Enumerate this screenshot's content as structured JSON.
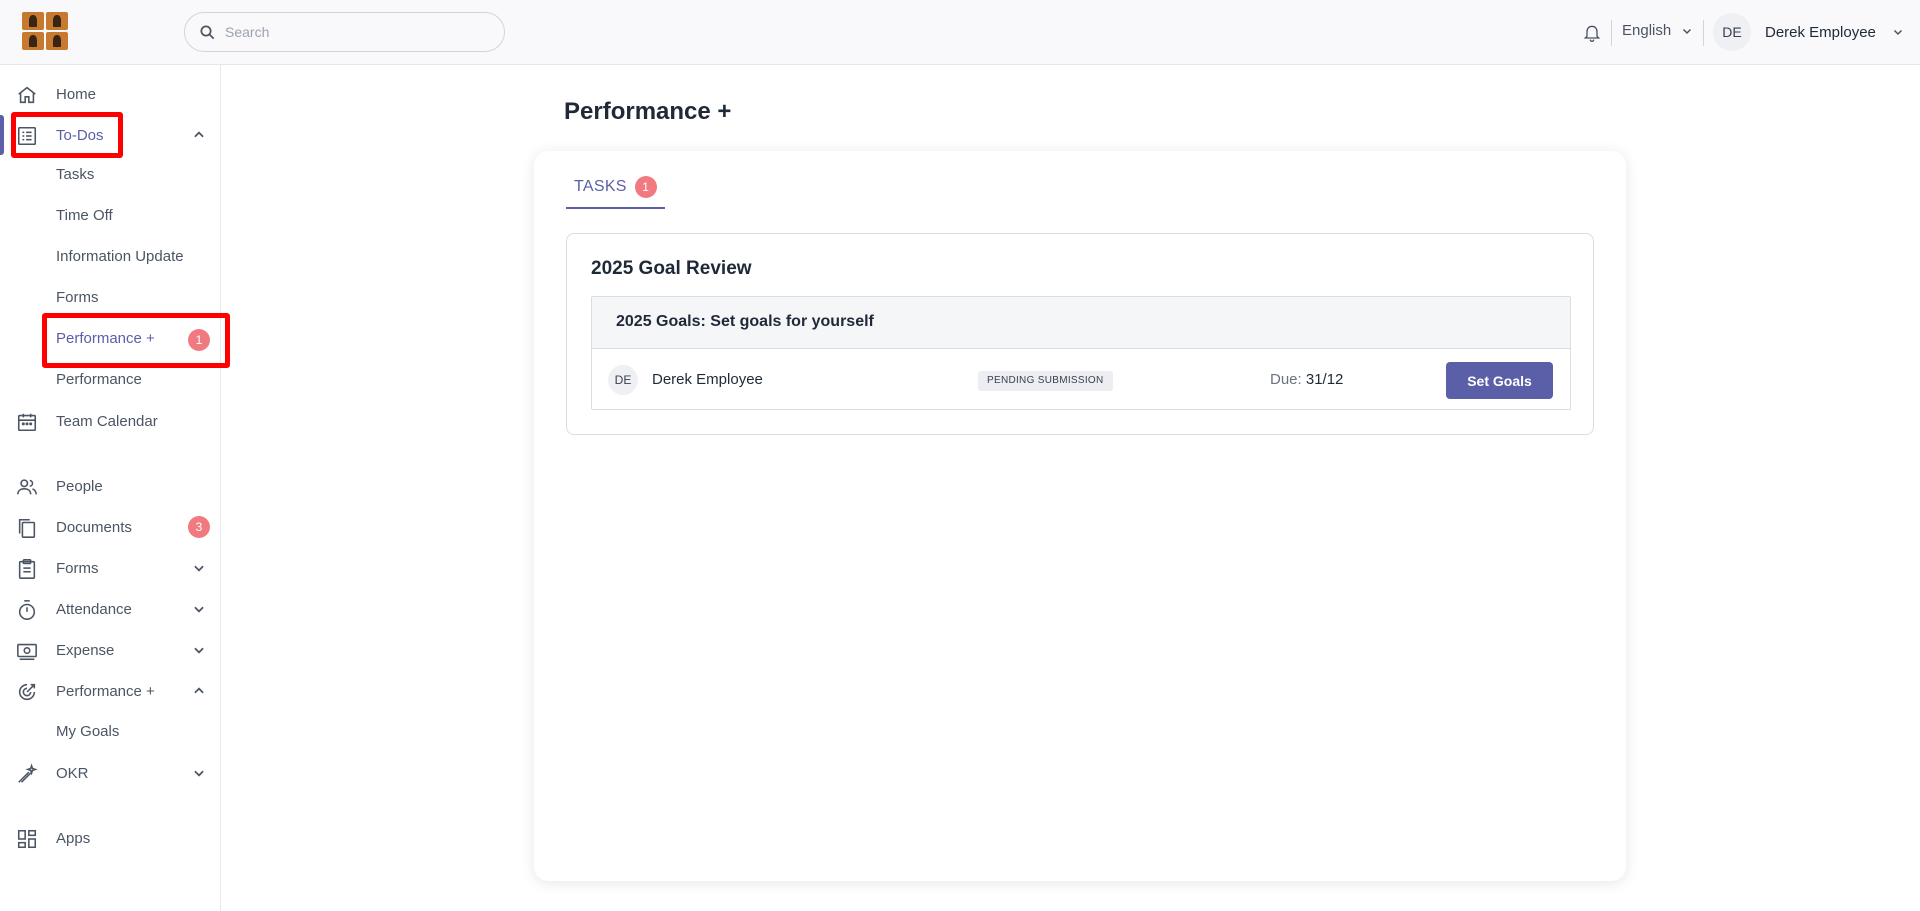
{
  "header": {
    "search_placeholder": "Search",
    "language": "English",
    "user_initials": "DE",
    "user_name": "Derek Employee"
  },
  "sidebar": {
    "items": [
      {
        "label": "Home",
        "icon": "home-icon"
      },
      {
        "label": "To-Dos",
        "icon": "list-icon"
      },
      {
        "label": "Team Calendar",
        "icon": "calendar-icon"
      },
      {
        "label": "People",
        "icon": "people-icon"
      },
      {
        "label": "Documents",
        "icon": "documents-icon",
        "badge": "3"
      },
      {
        "label": "Forms",
        "icon": "clipboard-icon"
      },
      {
        "label": "Attendance",
        "icon": "stopwatch-icon"
      },
      {
        "label": "Expense",
        "icon": "money-icon"
      },
      {
        "label": "Performance +",
        "icon": "performance-icon"
      },
      {
        "label": "OKR",
        "icon": "okr-icon"
      },
      {
        "label": "Apps",
        "icon": "apps-grid-icon"
      }
    ],
    "todos_sub": [
      {
        "label": "Tasks"
      },
      {
        "label": "Time Off"
      },
      {
        "label": "Information Update"
      },
      {
        "label": "Forms"
      },
      {
        "label": "Performance +",
        "badge": "1"
      },
      {
        "label": "Performance"
      }
    ],
    "performance_sub": [
      {
        "label": "My Goals"
      }
    ]
  },
  "main": {
    "page_title": "Performance +",
    "tab": {
      "label": "TASKS",
      "badge": "1"
    },
    "review": {
      "title": "2025 Goal Review",
      "goal_title": "2025 Goals: Set goals for yourself",
      "row": {
        "initials": "DE",
        "employee": "Derek Employee",
        "status": "PENDING SUBMISSION",
        "due_label": "Due:",
        "due_value": "31/12",
        "button": "Set Goals"
      }
    }
  },
  "colors": {
    "accent": "#5b5fa8",
    "badge": "#f07a80",
    "highlight": "#ff0000"
  }
}
